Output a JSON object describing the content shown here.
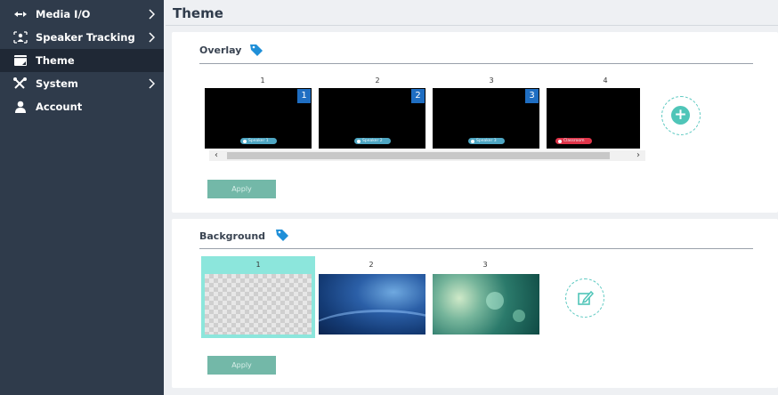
{
  "sidebar": {
    "items": [
      {
        "label": "Media I/O",
        "icon": "media-io-icon",
        "has_submenu": true
      },
      {
        "label": "Speaker Tracking",
        "icon": "speaker-tracking-icon",
        "has_submenu": true
      },
      {
        "label": "Theme",
        "icon": "theme-icon",
        "has_submenu": false,
        "active": true
      },
      {
        "label": "System",
        "icon": "system-tools-icon",
        "has_submenu": true
      },
      {
        "label": "Account",
        "icon": "account-icon",
        "has_submenu": false
      }
    ]
  },
  "page": {
    "title": "Theme"
  },
  "overlay": {
    "title": "Overlay",
    "columns": [
      "1",
      "2",
      "3",
      "4"
    ],
    "thumbnails": [
      {
        "badge": "1",
        "pill": "Speaker 1",
        "pill_color": "#4ea6c3"
      },
      {
        "badge": "2",
        "pill": "Speaker 2",
        "pill_color": "#4ea6c3"
      },
      {
        "badge": "3",
        "pill": "Speaker 3",
        "pill_color": "#4ea6c3"
      },
      {
        "badge": "",
        "pill": "Classroom",
        "pill_color": "#e0354a"
      }
    ],
    "apply_label": "Apply"
  },
  "background": {
    "title": "Background",
    "columns": [
      "1",
      "2",
      "3"
    ],
    "apply_label": "Apply"
  },
  "colors": {
    "sidebar_bg": "#2f3b4b",
    "sidebar_active": "#1f2835",
    "accent_teal": "#4fc5b8",
    "apply_button": "#73b8a8",
    "tag_blue": "#1f8fd8",
    "badge_blue": "#1f6ec2"
  },
  "scroll": {
    "left_arrow": "‹",
    "right_arrow": "›"
  },
  "add_symbol": "+"
}
